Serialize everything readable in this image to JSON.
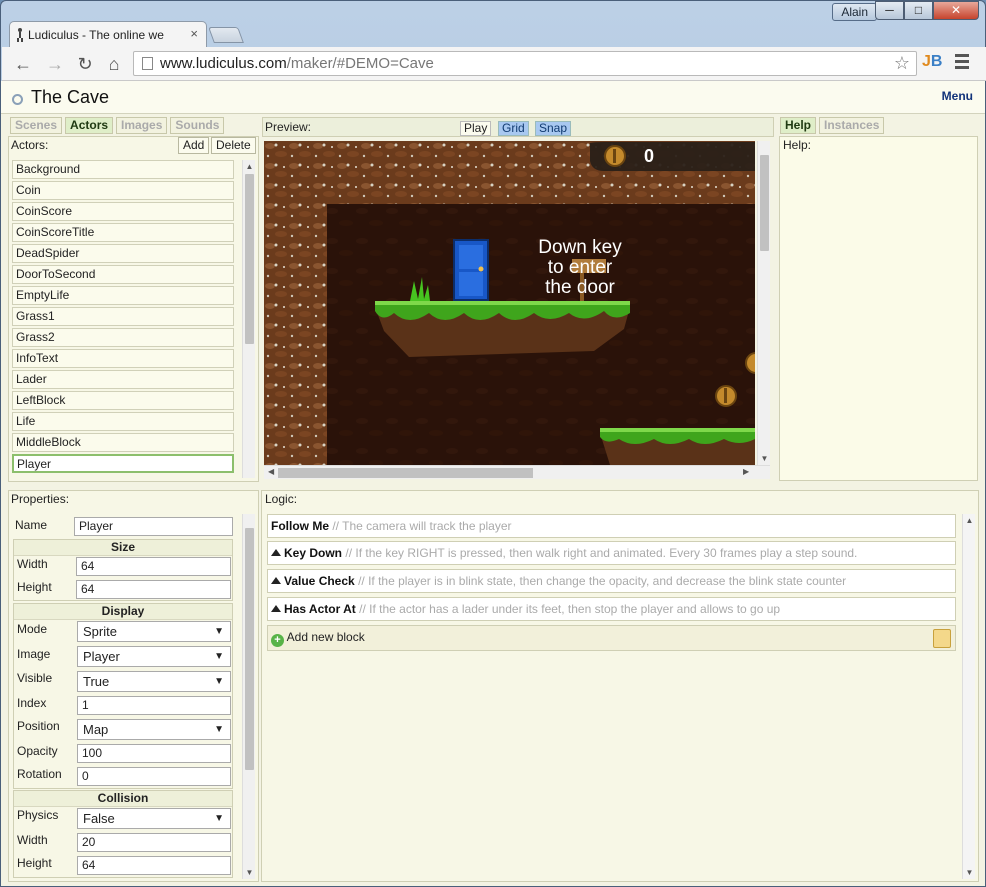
{
  "window": {
    "user": "Alain",
    "minimize": "─",
    "maximize": "□",
    "close": "✕"
  },
  "browser": {
    "tab_title": "Ludiculus - The online we",
    "tab_close": "×",
    "url_host": "www.ludiculus.com",
    "url_path": "/maker/#DEMO=Cave",
    "back": "←",
    "forward": "→",
    "reload": "↻",
    "home": "⌂",
    "star": "☆",
    "ext_j": "J",
    "ext_b": "B"
  },
  "app": {
    "title": "The Cave",
    "menu_label": "Menu"
  },
  "left_tabs": [
    {
      "label": "Scenes",
      "active": false
    },
    {
      "label": "Actors",
      "active": true
    },
    {
      "label": "Images",
      "active": false
    },
    {
      "label": "Sounds",
      "active": false
    }
  ],
  "actors_panel": {
    "label": "Actors:",
    "add": "Add",
    "delete": "Delete",
    "items": [
      "Background",
      "Coin",
      "CoinScore",
      "CoinScoreTitle",
      "DeadSpider",
      "DoorToSecond",
      "EmptyLife",
      "Grass1",
      "Grass2",
      "InfoText",
      "Lader",
      "LeftBlock",
      "Life",
      "MiddleBlock",
      "Player"
    ],
    "selected": "Player"
  },
  "preview": {
    "label": "Preview:",
    "play": "Play",
    "grid": "Grid",
    "snap": "Snap",
    "score": "0",
    "sign_text_1": "Down key",
    "sign_text_2": "to enter",
    "sign_text_3": "the door"
  },
  "right_tabs": [
    {
      "label": "Help",
      "active": true
    },
    {
      "label": "Instances",
      "active": false
    }
  ],
  "help": {
    "label": "Help:"
  },
  "properties": {
    "label": "Properties:",
    "name_label": "Name",
    "name_value": "Player",
    "size": {
      "header": "Size",
      "width_label": "Width",
      "width": "64",
      "height_label": "Height",
      "height": "64"
    },
    "display": {
      "header": "Display",
      "mode_label": "Mode",
      "mode": "Sprite",
      "image_label": "Image",
      "image": "Player",
      "visible_label": "Visible",
      "visible": "True",
      "index_label": "Index",
      "index": "1",
      "position_label": "Position",
      "position": "Map",
      "opacity_label": "Opacity",
      "opacity": "100",
      "rotation_label": "Rotation",
      "rotation": "0"
    },
    "collision": {
      "header": "Collision",
      "physics_label": "Physics",
      "physics": "False",
      "width_label": "Width",
      "width": "20",
      "height_label": "Height",
      "height": "64"
    }
  },
  "logic": {
    "label": "Logic:",
    "blocks": [
      {
        "title": "Follow Me",
        "comment": "// The camera will track the player"
      },
      {
        "title": "Key Down",
        "comment": "// If the key RIGHT is pressed, then walk right and animated. Every 30 frames play a step sound."
      },
      {
        "title": "Value Check",
        "comment": "// If the player is in blink state, then change the opacity, and decrease the blink state counter"
      },
      {
        "title": "Has Actor At",
        "comment": "// If the actor has a lader under its feet, then stop the player and allows to go up"
      }
    ],
    "add_block": "Add new block"
  }
}
